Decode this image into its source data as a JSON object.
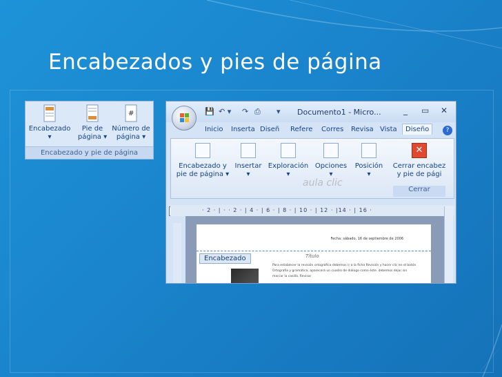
{
  "slide": {
    "title": "Encabezados y pies de página"
  },
  "small_group": {
    "buttons": [
      {
        "line1": "Encabezado",
        "line2": "▾"
      },
      {
        "line1": "Pie de",
        "line2": "página ▾"
      },
      {
        "line1": "Número de",
        "line2": "página ▾"
      }
    ],
    "group_label": "Encabezado y pie de página"
  },
  "word": {
    "title": "Documento1 - Micro...",
    "controls": {
      "minimize": "_",
      "maximize": "▭",
      "close": "✕"
    },
    "tabs": [
      "Inicio",
      "Inserta",
      "Diseñ",
      "Refere",
      "Corres",
      "Revisa",
      "Vista",
      "Diseño"
    ],
    "help": "?",
    "ribbon": [
      {
        "line1": "Encabezado y",
        "line2": "pie de página ▾"
      },
      {
        "line1": "Insertar",
        "line2": "▾"
      },
      {
        "line1": "Exploración",
        "line2": "▾"
      },
      {
        "line1": "Opciones",
        "line2": "▾"
      },
      {
        "line1": "Posición",
        "line2": "▾"
      },
      {
        "line1": "Cerrar encabez",
        "line2": "y pie de pági"
      }
    ],
    "cerrar_group": "Cerrar",
    "ruler": "· 2 · | · · 2 · | 4 · | 6 · | 8 · | 10 · | 12 · |14 · | 16 ·",
    "doc": {
      "date": "Fecha: sábado, 16 de septiembre de 2006",
      "header_tag": "Encabezado",
      "heading": "Título",
      "body": "Para establecer la revisión ortográfica debemos ir a la ficha Revisión y hacer clic en el botón Ortografía y gramática, aparecerá un cuadro de diálogo como éste. debemos dejar sin marcar la casilla. Revisar",
      "watermark": "aula clic"
    }
  },
  "colors": {
    "background": "#1a84cc",
    "ribbon": "#dbe8f7"
  }
}
